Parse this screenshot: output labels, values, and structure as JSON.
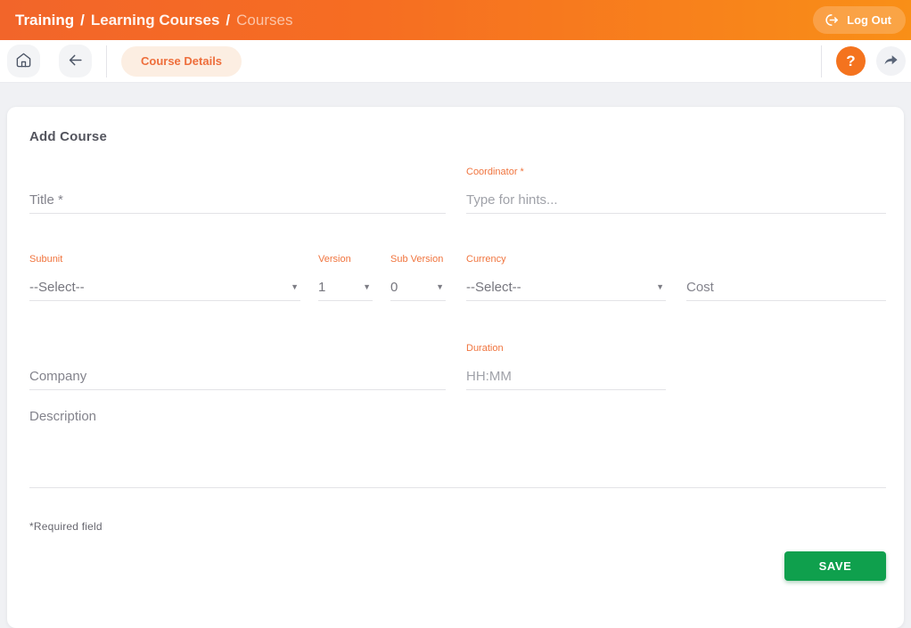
{
  "topbar": {
    "breadcrumb": {
      "level1": "Training",
      "sep": "/",
      "level2": "Learning Courses",
      "level3": "Courses"
    },
    "logout_label": "Log Out"
  },
  "toolbar": {
    "course_details_chip": "Course Details",
    "help_glyph": "?"
  },
  "page": {
    "heading": "Add Course"
  },
  "fields": {
    "title": {
      "placeholder": "Title *"
    },
    "coordinator": {
      "label": "Coordinator *",
      "placeholder": "Type for hints..."
    },
    "subunit": {
      "label": "Subunit",
      "value": "--Select--"
    },
    "version": {
      "label": "Version",
      "value": "1"
    },
    "sub_version": {
      "label": "Sub Version",
      "value": "0"
    },
    "currency": {
      "label": "Currency",
      "value": "--Select--"
    },
    "cost": {
      "placeholder": "Cost"
    },
    "company": {
      "placeholder": "Company"
    },
    "duration": {
      "label": "Duration",
      "placeholder": "HH:MM"
    },
    "description": {
      "placeholder": "Description"
    }
  },
  "footer": {
    "required_note": "*Required field",
    "save_label": "SAVE"
  },
  "icons": {
    "dropdown": "▼"
  },
  "colors": {
    "topbar_gradient_start": "#F2652A",
    "topbar_gradient_end": "#F98F17",
    "accent_label_orange": "#F0743E",
    "chip_bg": "#FCEEE2",
    "chip_text": "#EE6E3B",
    "help_circle_orange": "#F4731E",
    "save_green": "#0FA04D"
  }
}
